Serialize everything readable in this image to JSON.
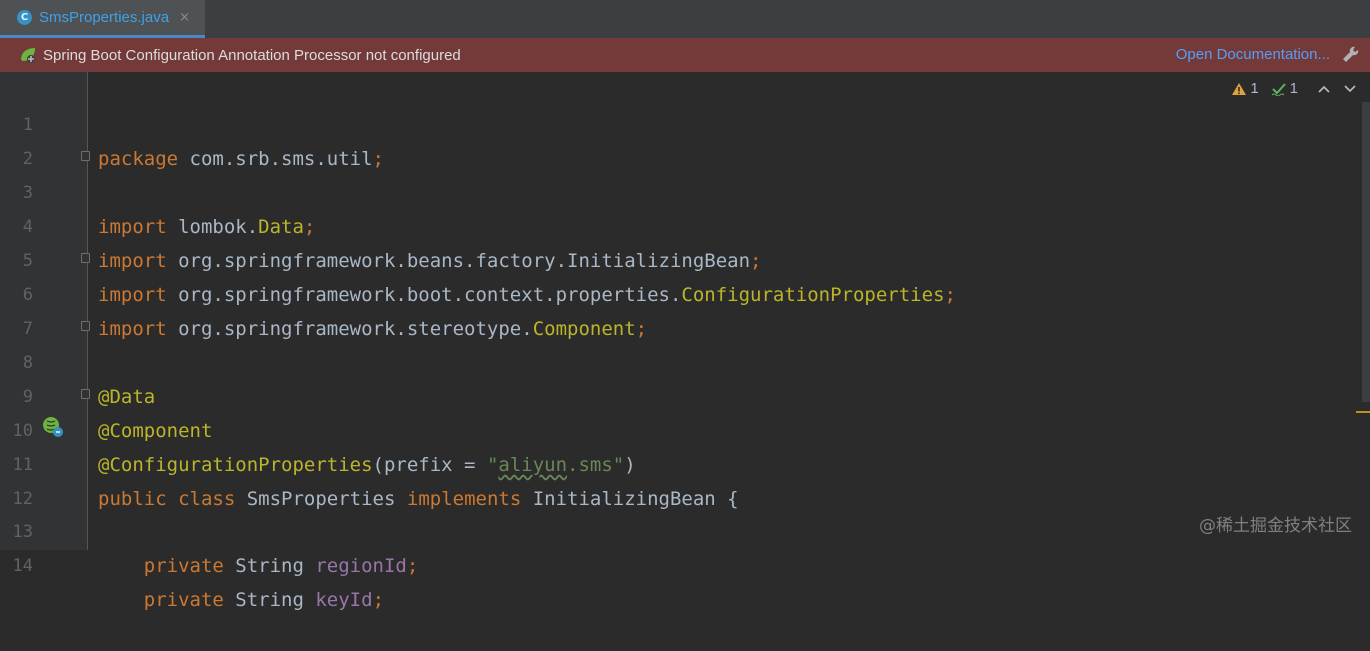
{
  "tab": {
    "icon_letter": "C",
    "filename": "SmsProperties.java",
    "close": "×"
  },
  "banner": {
    "message": "Spring Boot Configuration Annotation Processor not configured",
    "link": "Open Documentation..."
  },
  "inspections": {
    "warnings": "1",
    "typos": "1"
  },
  "lines": [
    {
      "n": "1"
    },
    {
      "n": "2"
    },
    {
      "n": "3"
    },
    {
      "n": "4"
    },
    {
      "n": "5"
    },
    {
      "n": "6"
    },
    {
      "n": "7"
    },
    {
      "n": "8"
    },
    {
      "n": "9"
    },
    {
      "n": "10"
    },
    {
      "n": "11"
    },
    {
      "n": "12"
    },
    {
      "n": "13"
    },
    {
      "n": "14"
    }
  ],
  "code": {
    "l1": {
      "kw": "package",
      "rest": " com.srb.sms.util",
      "semi": ";"
    },
    "l3": {
      "kw": "import",
      "pkg": " lombok.",
      "cls": "Data",
      "semi": ";"
    },
    "l4": {
      "kw": "import",
      "rest": " org.springframework.beans.factory.InitializingBean",
      "semi": ";"
    },
    "l5": {
      "kw": "import",
      "pkg": " org.springframework.boot.context.properties.",
      "cls": "ConfigurationProperties",
      "semi": ";"
    },
    "l6": {
      "kw": "import",
      "pkg": " org.springframework.stereotype.",
      "cls": "Component",
      "semi": ";"
    },
    "l8": {
      "ann": "@Data"
    },
    "l9": {
      "ann": "@Component"
    },
    "l10": {
      "ann": "@ConfigurationProperties",
      "open": "(prefix = ",
      "q1": "\"",
      "typo": "aliyun",
      "strrest": ".sms\"",
      "close": ")"
    },
    "l11": {
      "kw1": "public",
      "kw2": " class",
      "name": " SmsProperties ",
      "kw3": "implements",
      "iface": " InitializingBean {"
    },
    "l13": {
      "kw": "    private",
      "type": " String ",
      "field": "regionId",
      "semi": ";"
    },
    "l14": {
      "kw": "    private",
      "type": " String ",
      "field": "keyId",
      "semi": ";"
    }
  },
  "watermark": "@稀土掘金技术社区",
  "colors": {
    "keyword": "#cc7832",
    "annotation": "#bbb529",
    "string": "#6a8759",
    "field": "#9876aa",
    "text": "#a9b7c6",
    "banner_bg": "#743a3a"
  }
}
